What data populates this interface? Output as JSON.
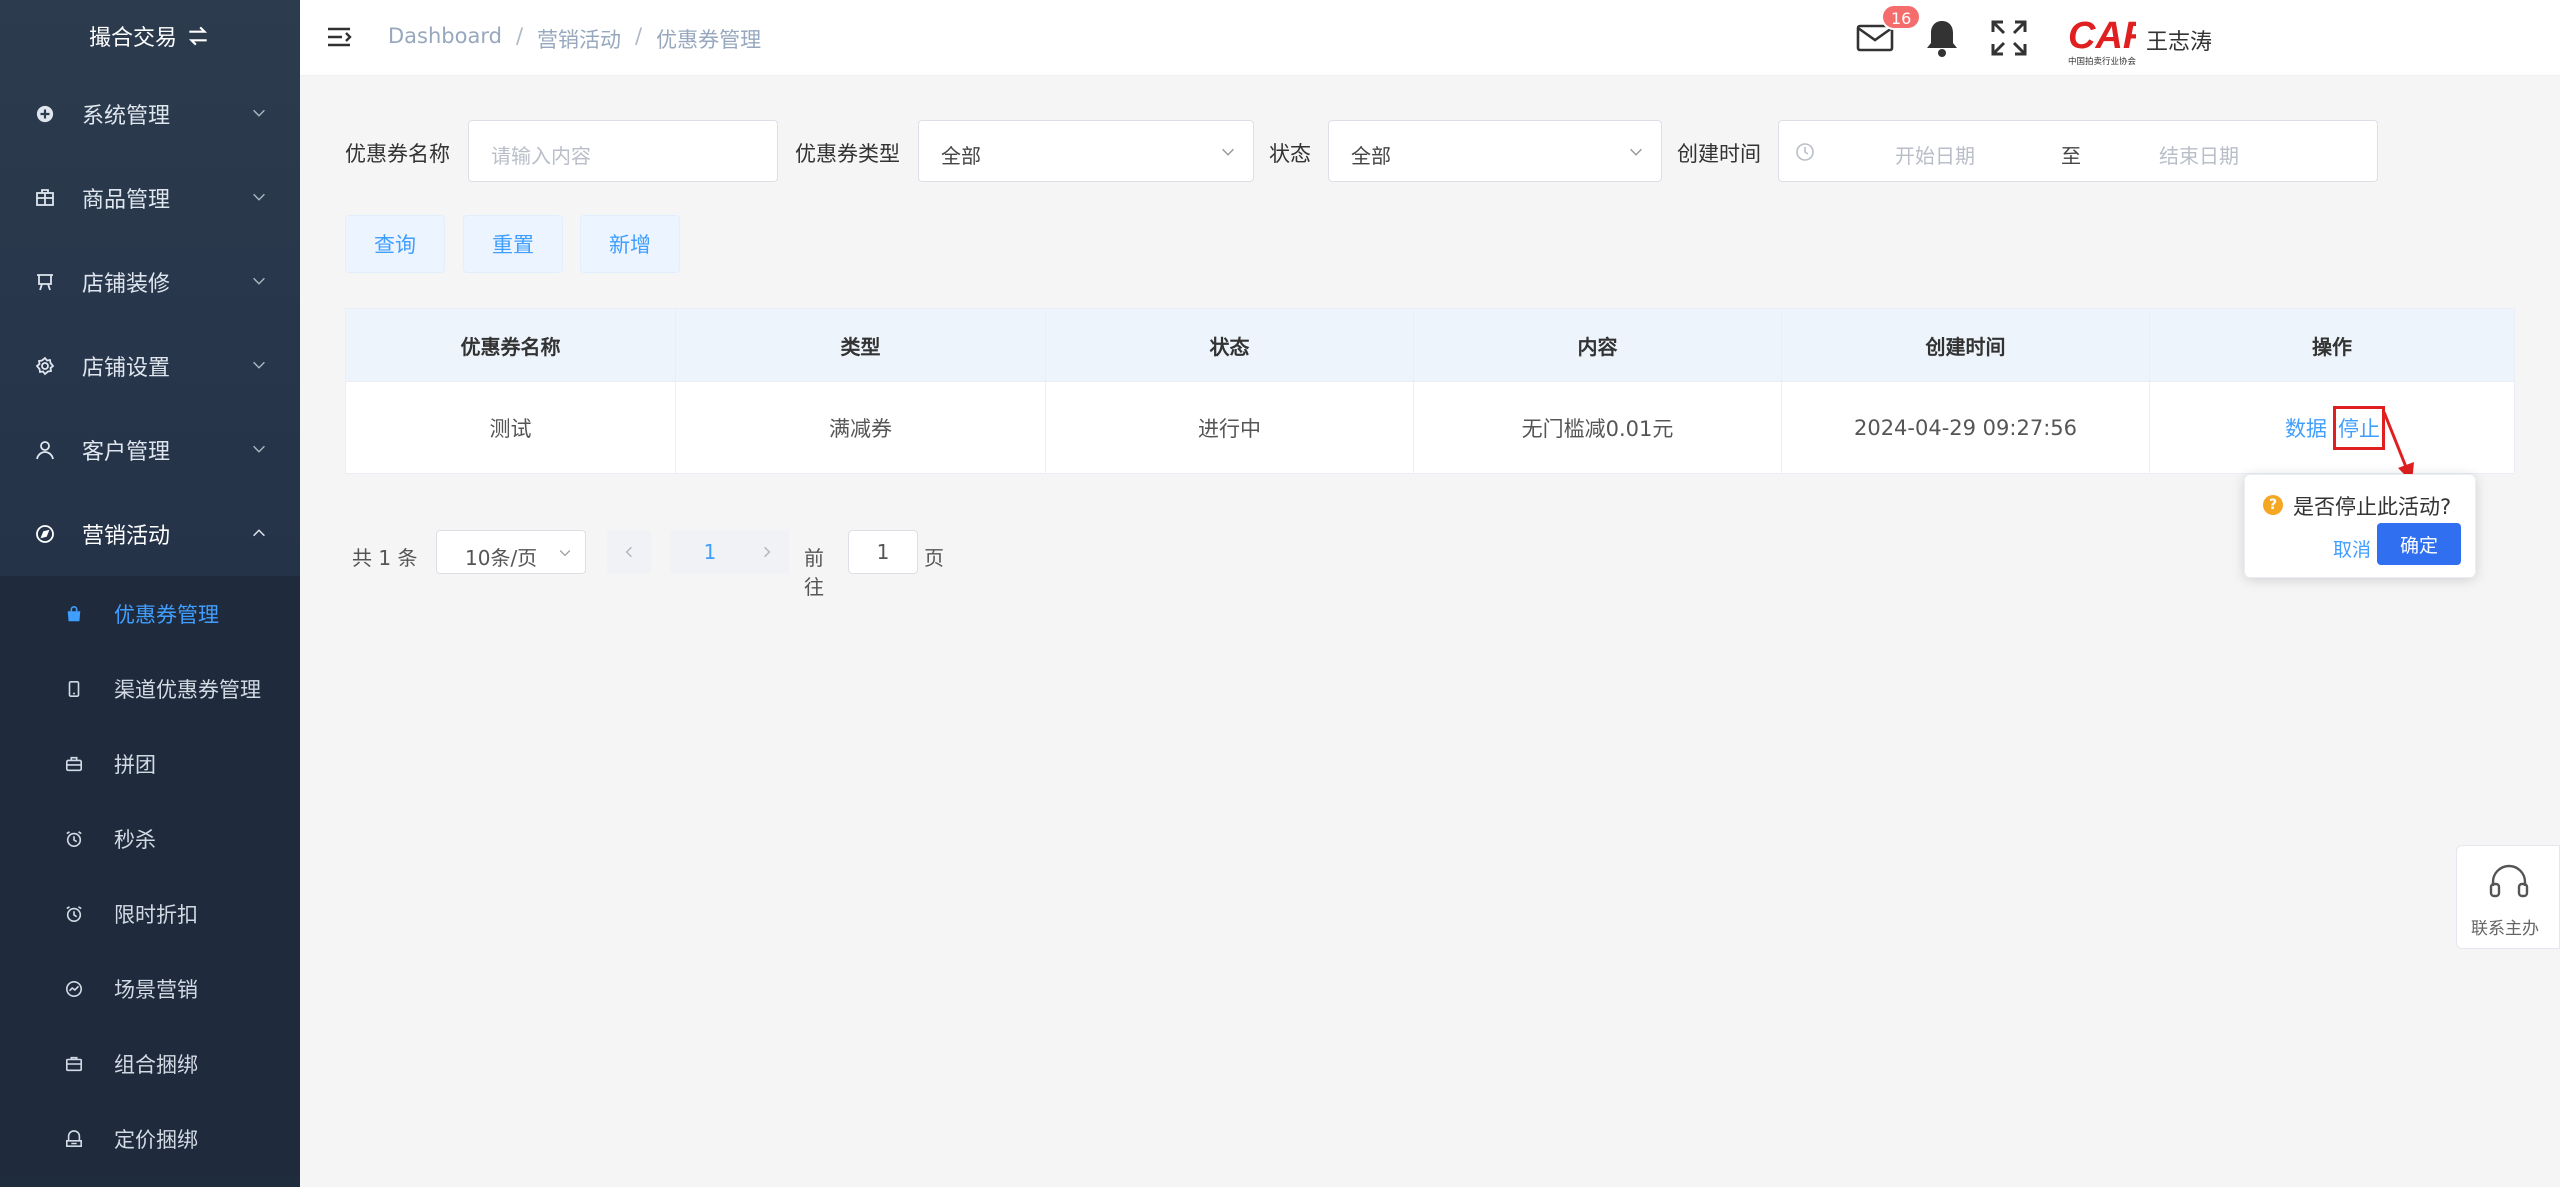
{
  "sidebar": {
    "brand": "撮合交易",
    "menu": [
      {
        "label": "系统管理",
        "icon": "plus-circle-icon"
      },
      {
        "label": "商品管理",
        "icon": "goods-icon"
      },
      {
        "label": "店铺装修",
        "icon": "easel-icon"
      },
      {
        "label": "店铺设置",
        "icon": "settings-icon"
      },
      {
        "label": "客户管理",
        "icon": "user-icon"
      },
      {
        "label": "营销活动",
        "icon": "compass-icon"
      }
    ],
    "submenu": [
      {
        "label": "优惠券管理",
        "icon": "shopping-bag-icon",
        "active": true
      },
      {
        "label": "渠道优惠券管理",
        "icon": "phone-icon"
      },
      {
        "label": "拼团",
        "icon": "briefcase-icon"
      },
      {
        "label": "秒杀",
        "icon": "alarm-clock-icon"
      },
      {
        "label": "限时折扣",
        "icon": "alarm-clock-icon"
      },
      {
        "label": "场景营销",
        "icon": "chart-circle-icon"
      },
      {
        "label": "组合捆绑",
        "icon": "box-icon"
      },
      {
        "label": "定价捆绑",
        "icon": "gift-icon"
      }
    ]
  },
  "header": {
    "breadcrumb": [
      "Dashboard",
      "营销活动",
      "优惠券管理"
    ],
    "mail_badge": "16",
    "logo_text": "CAF",
    "logo_subtext": "中国拍卖行业协会",
    "username": "王志涛"
  },
  "filters": {
    "name_label": "优惠券名称",
    "name_placeholder": "请输入内容",
    "type_label": "优惠券类型",
    "type_value": "全部",
    "status_label": "状态",
    "status_value": "全部",
    "time_label": "创建时间",
    "start_placeholder": "开始日期",
    "range_sep": "至",
    "end_placeholder": "结束日期"
  },
  "buttons": {
    "query": "查询",
    "reset": "重置",
    "add": "新增"
  },
  "table": {
    "headers": [
      "优惠券名称",
      "类型",
      "状态",
      "内容",
      "创建时间",
      "操作"
    ],
    "rows": [
      {
        "name": "测试",
        "type": "满减券",
        "status": "进行中",
        "content": "无门槛减0.01元",
        "created": "2024-04-29 09:27:56",
        "op_data": "数据",
        "op_stop": "停止"
      }
    ]
  },
  "pagination": {
    "total": "共 1 条",
    "page_size": "10条/页",
    "current": "1",
    "goto_label": "前往",
    "goto_value": "1",
    "page_suffix": "页"
  },
  "popconfirm": {
    "question_mark": "?",
    "text": "是否停止此活动?",
    "cancel": "取消",
    "confirm": "确定"
  },
  "contact": {
    "label": "联系主办"
  },
  "colors": {
    "primary": "#409eff",
    "confirm": "#2f6ff0",
    "badge": "#f56c6c",
    "sidebar_bg": "#26344a",
    "annotation": "#e02020"
  }
}
